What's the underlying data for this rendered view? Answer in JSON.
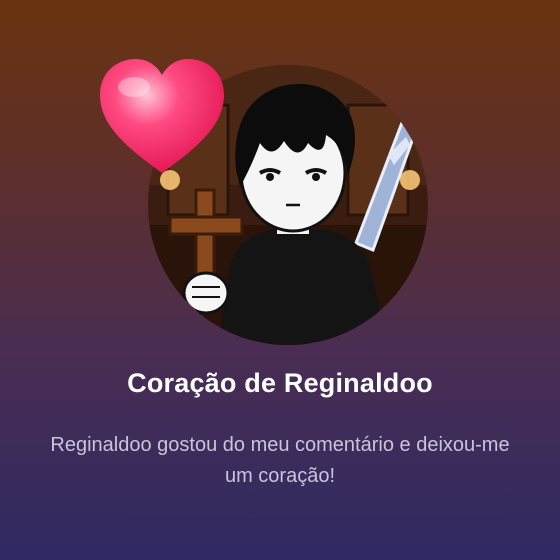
{
  "notification": {
    "title": "Coração de Reginaldoo",
    "message": "Reginaldoo gostou do meu comentário e deixou-me um coração!",
    "avatar_icon": "profile-picture-character",
    "badge_icon": "heart-icon",
    "colors": {
      "background_top": "#6a3310",
      "background_bottom": "#2f2a63",
      "title_text": "#ffffff",
      "message_text": "#c9c4dc",
      "heart": "#ff2d6b"
    }
  }
}
